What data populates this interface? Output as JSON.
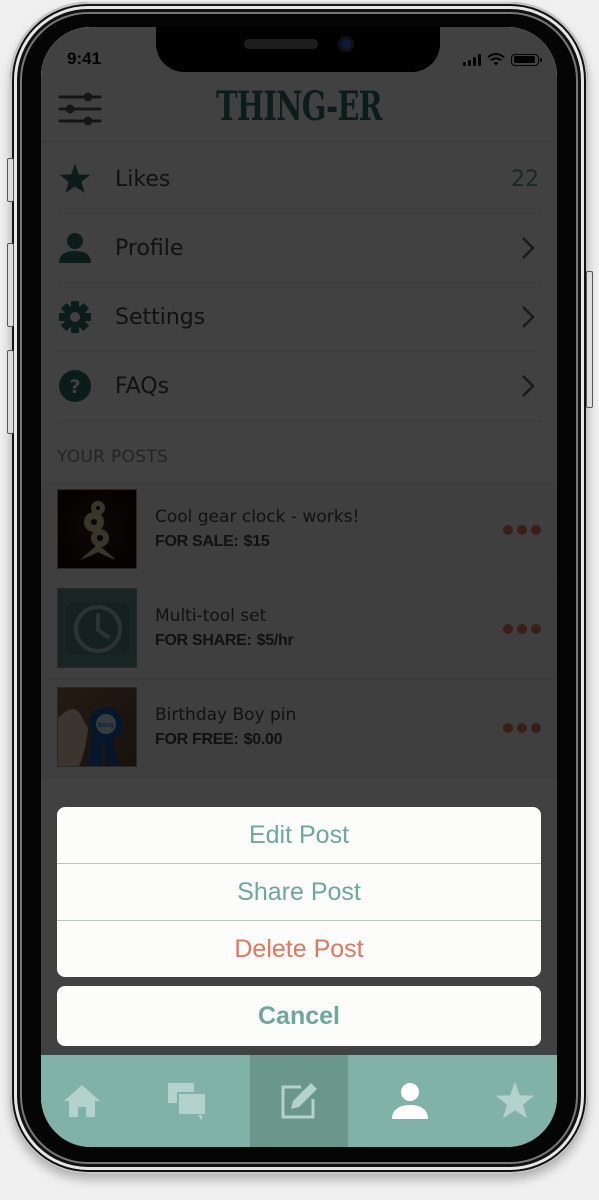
{
  "status_bar": {
    "time": "9:41",
    "signal_bars": 4,
    "battery_level": 1.0,
    "icons": [
      "cellular-signal-icon",
      "wifi-icon",
      "battery-icon"
    ]
  },
  "header": {
    "menu_icon": "sliders-menu-icon",
    "logo": "THING-ER"
  },
  "menu": {
    "items": [
      {
        "icon": "star-icon",
        "label": "Likes",
        "value": "22"
      },
      {
        "icon": "person-icon",
        "label": "Profile",
        "chevron": true
      },
      {
        "icon": "gear-icon",
        "label": "Settings",
        "chevron": true
      },
      {
        "icon": "question-icon",
        "label": "FAQs",
        "chevron": true
      }
    ]
  },
  "posts_section": {
    "title": "YOUR POSTS",
    "posts": [
      {
        "title": "Cool gear clock - works!",
        "price_label": "FOR SALE:",
        "price": "$15",
        "thumb": "gear-clock-photo"
      },
      {
        "title": "Multi-tool set",
        "price_label": "FOR SHARE:",
        "price": "$5/hr",
        "thumb": "clock-placeholder-icon"
      },
      {
        "title": "Birthday Boy pin",
        "price_label": "FOR FREE:",
        "price": "$0.00",
        "thumb": "birthday-pin-photo"
      }
    ]
  },
  "action_sheet": {
    "actions": [
      {
        "label": "Edit Post",
        "style": "default"
      },
      {
        "label": "Share Post",
        "style": "default"
      },
      {
        "label": "Delete Post",
        "style": "destructive"
      }
    ],
    "cancel_label": "Cancel"
  },
  "tab_bar": {
    "tabs": [
      {
        "icon": "home-icon",
        "active": false
      },
      {
        "icon": "chat-bubbles-icon",
        "active": false
      },
      {
        "icon": "compose-icon",
        "active": true
      },
      {
        "icon": "person-icon",
        "active": false
      },
      {
        "icon": "star-icon",
        "active": false
      }
    ]
  },
  "colors": {
    "brand_green": "#2f6b5c",
    "accent_teal": "#6aa99c",
    "destructive": "#e9735c",
    "tabbar_bg": "#80b2a7",
    "tabbar_active": "#6a968c",
    "more_dots": "#e07a5f"
  }
}
